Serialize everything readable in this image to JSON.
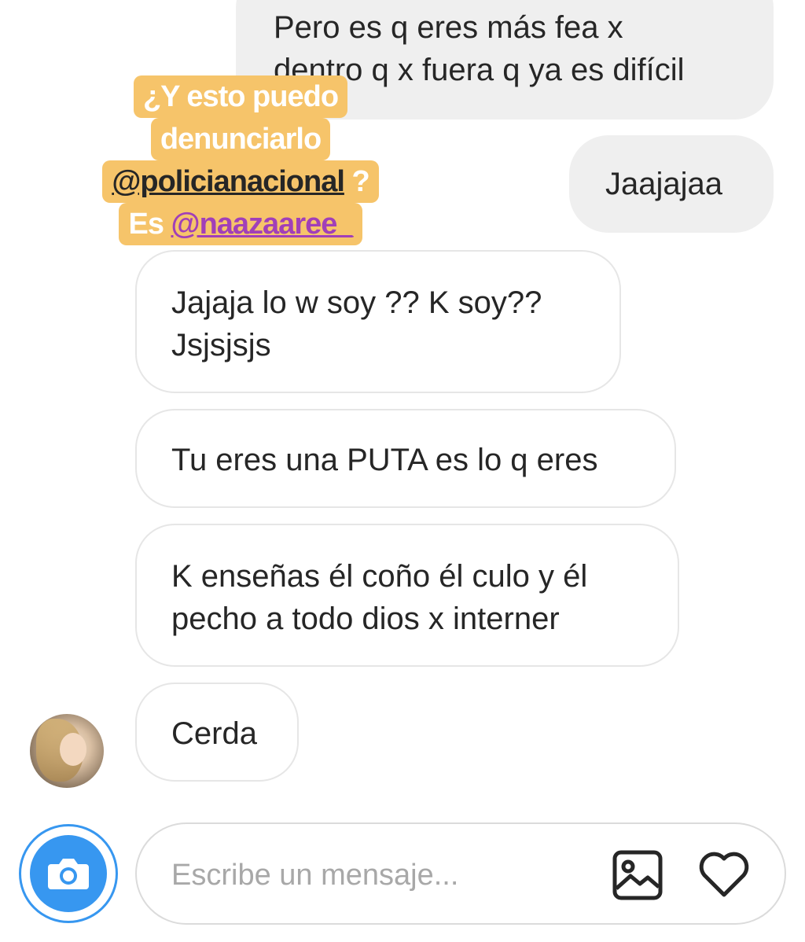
{
  "thread": {
    "messages": [
      {
        "direction": "sent",
        "text": "Pero es q eres más fea x\ndentro q x fuera q ya es difícil"
      },
      {
        "direction": "sent",
        "text": "Jaajajaa"
      },
      {
        "direction": "received",
        "text": "Jajaja lo w soy ?? K soy??\nJsjsjsjs"
      },
      {
        "direction": "received",
        "text": "Tu eres una PUTA es lo q eres"
      },
      {
        "direction": "received",
        "text": "K enseñas él coño él culo y él\npecho a todo dios x interner"
      },
      {
        "direction": "received",
        "text": "Cerda"
      }
    ]
  },
  "overlay": {
    "line1": "¿Y esto puedo",
    "line2": "denunciarlo",
    "mention1": "@policianacional",
    "line3_suffix": " ?",
    "line4_prefix": "Es ",
    "mention2": "@naazaaree_"
  },
  "composer": {
    "placeholder": "Escribe un mensaje...",
    "camera_icon": "camera-icon",
    "gallery_icon": "image-icon",
    "like_icon": "heart-icon"
  },
  "colors": {
    "accent": "#3797f0",
    "sticker_bg": "#f6c46a",
    "mention_purple": "#a13fb8"
  }
}
